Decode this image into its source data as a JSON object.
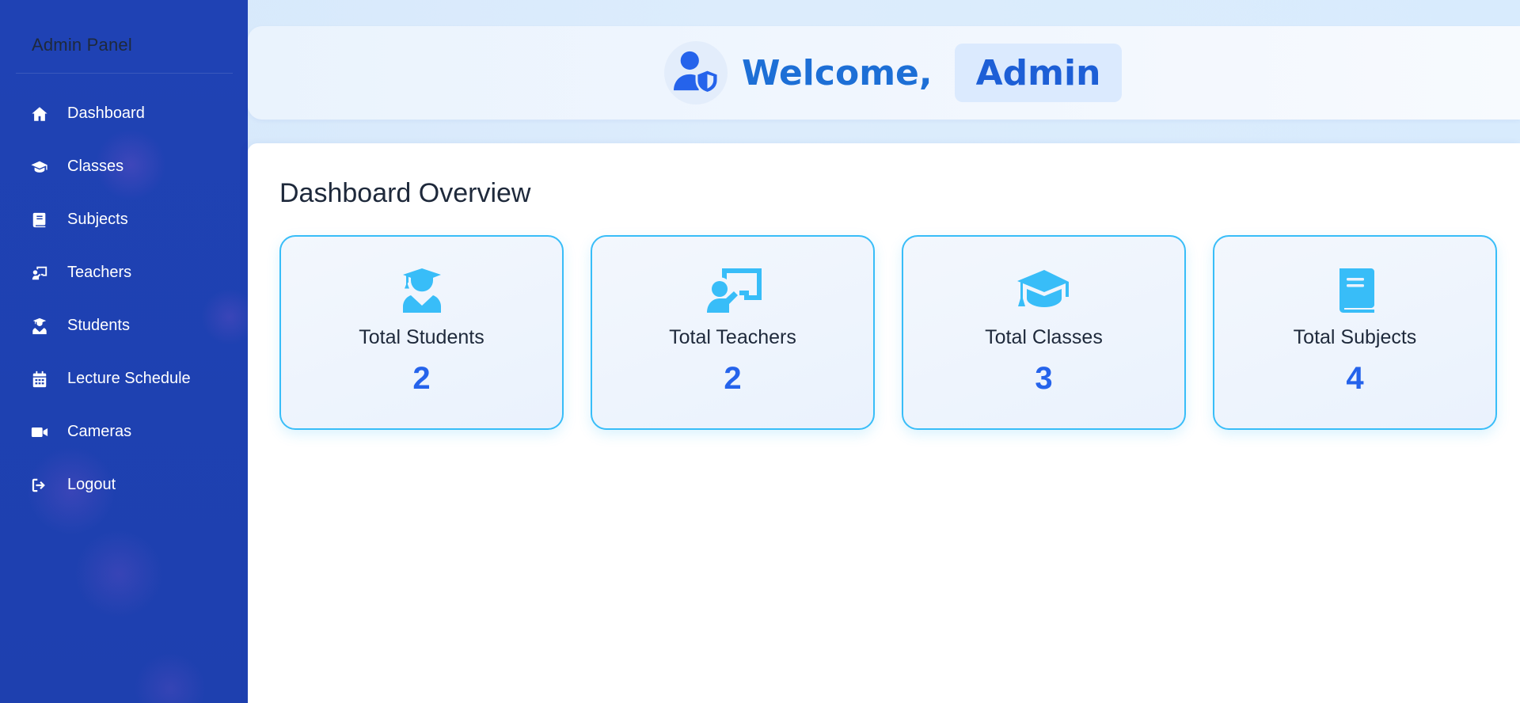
{
  "sidebar": {
    "brand": "Admin Panel",
    "items": [
      {
        "label": "Dashboard",
        "icon": "home-icon"
      },
      {
        "label": "Classes",
        "icon": "graduation-cap-icon"
      },
      {
        "label": "Subjects",
        "icon": "book-icon"
      },
      {
        "label": "Teachers",
        "icon": "chalkboard-teacher-icon"
      },
      {
        "label": "Students",
        "icon": "user-graduate-icon"
      },
      {
        "label": "Lecture Schedule",
        "icon": "calendar-icon"
      },
      {
        "label": "Cameras",
        "icon": "video-camera-icon"
      },
      {
        "label": "Logout",
        "icon": "sign-out-icon"
      }
    ]
  },
  "header": {
    "welcome": "Welcome,",
    "user": "Admin",
    "avatar_icon": "user-shield-icon"
  },
  "main": {
    "title": "Dashboard Overview",
    "cards": [
      {
        "label": "Total Students",
        "value": "2",
        "icon": "user-graduate-icon"
      },
      {
        "label": "Total Teachers",
        "value": "2",
        "icon": "chalkboard-teacher-icon"
      },
      {
        "label": "Total Classes",
        "value": "3",
        "icon": "graduation-cap-icon"
      },
      {
        "label": "Total Subjects",
        "value": "4",
        "icon": "book-icon"
      }
    ]
  },
  "colors": {
    "sidebar_bg": "#1e40af",
    "accent": "#2563eb",
    "card_border": "#38bdf8",
    "card_icon": "#38bdf8"
  }
}
